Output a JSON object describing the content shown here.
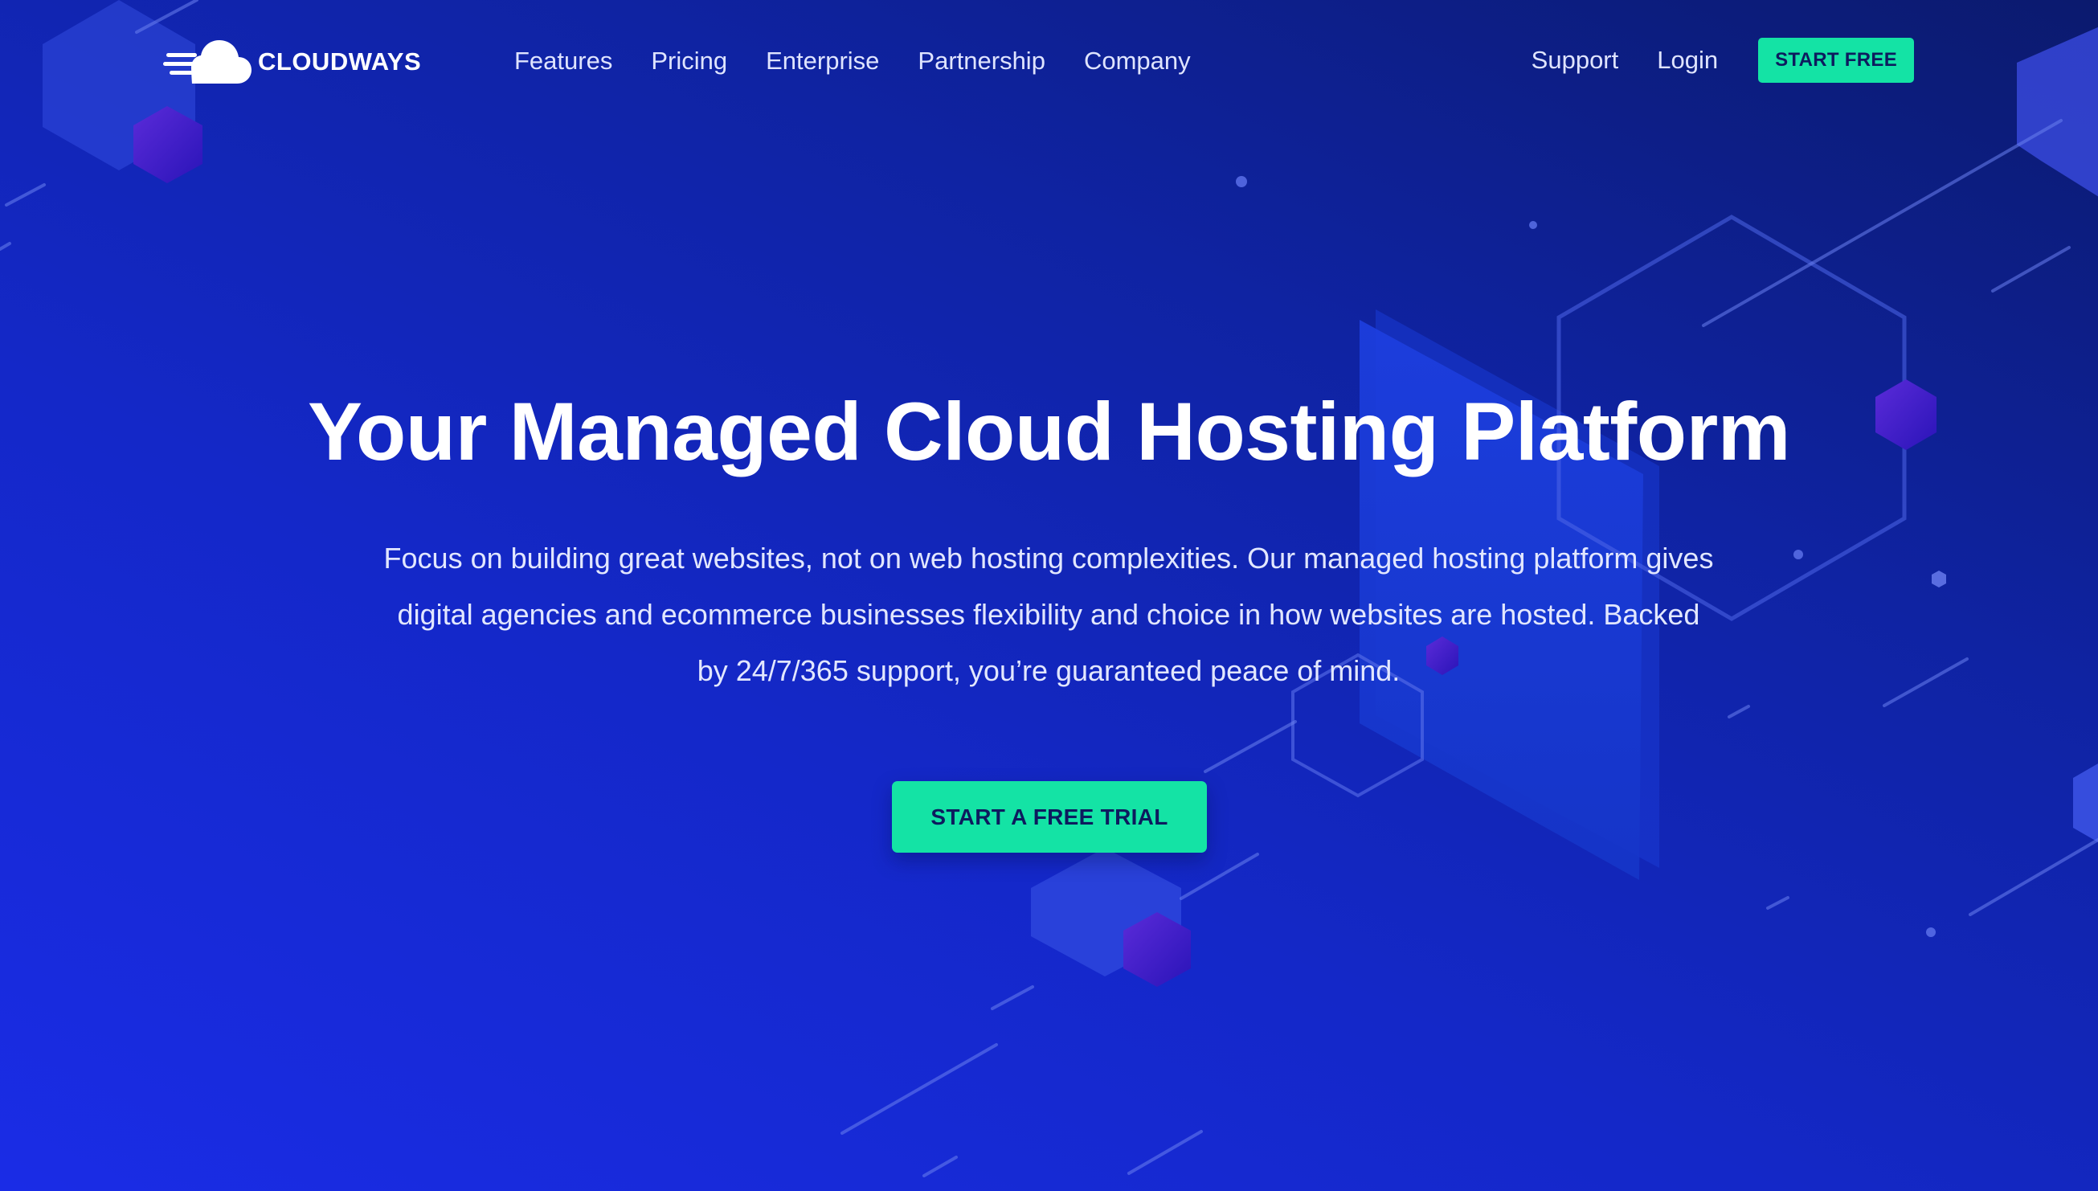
{
  "brand": {
    "name": "CLOUDWAYS",
    "logo_icon": "cloud-speed-icon"
  },
  "nav": {
    "links": [
      {
        "label": "Features"
      },
      {
        "label": "Pricing"
      },
      {
        "label": "Enterprise"
      },
      {
        "label": "Partnership"
      },
      {
        "label": "Company"
      }
    ],
    "support_label": "Support",
    "login_label": "Login",
    "cta_label": "START FREE"
  },
  "hero": {
    "title": "Your Managed Cloud Hosting Platform",
    "subtitle_lines": [
      "Focus on building great websites, not on web hosting complexities. Our managed hosting platform gives",
      "digital agencies and ecommerce businesses flexibility and choice in how websites are hosted. Backed",
      "by 24/7/365 support, you’re guaranteed peace of mind."
    ],
    "cta_label": "START A FREE TRIAL"
  },
  "colors": {
    "background_top": "#0b1a6e",
    "background_bottom": "#1a2ce6",
    "accent": "#14e3a5",
    "button_text": "#0d1b5e",
    "text": "#ffffff"
  }
}
